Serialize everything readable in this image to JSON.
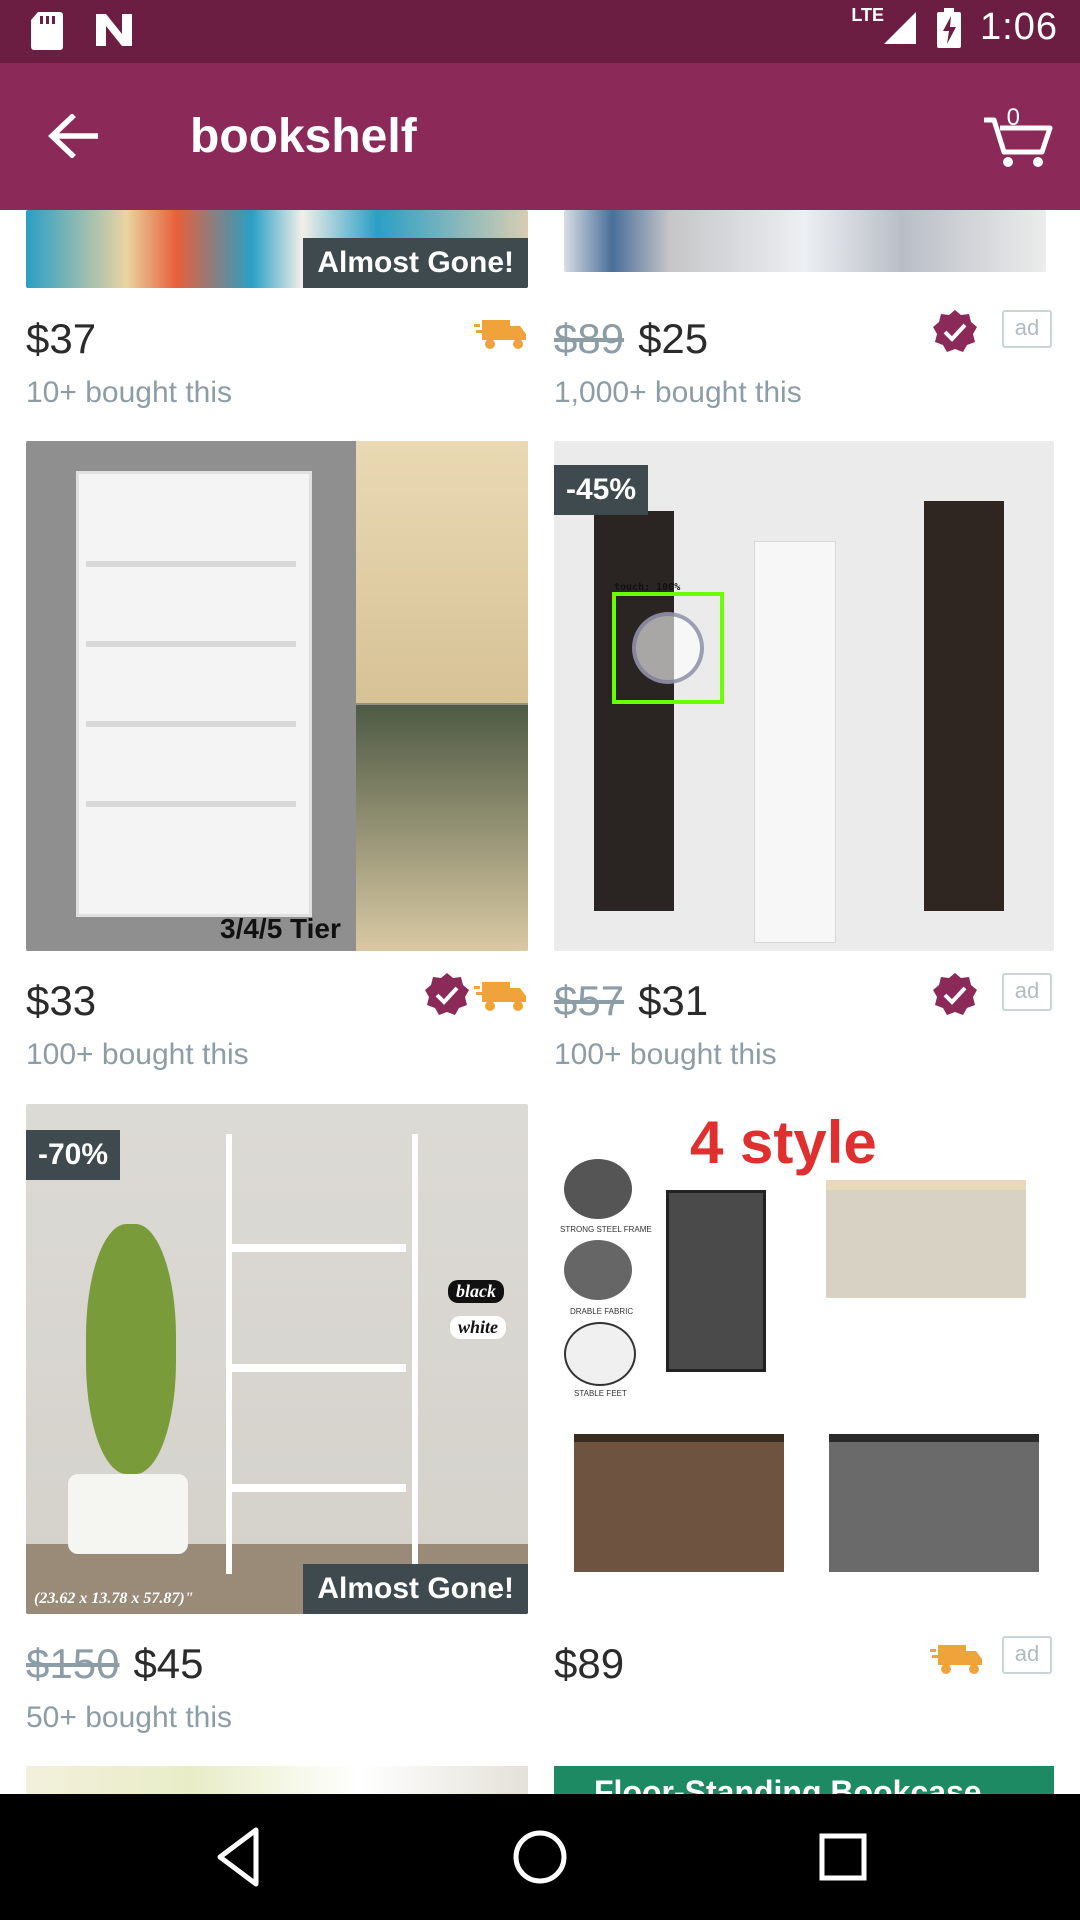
{
  "status_bar": {
    "time": "1:06",
    "network": "LTE"
  },
  "app_bar": {
    "title": "bookshelf",
    "cart_count": "0"
  },
  "products": [
    {
      "new_price": "$37",
      "old_price": "",
      "bought": "10+ bought this",
      "badge_br": "Almost Gone!",
      "badge_tl": "",
      "truck": true,
      "verified": false,
      "ad": false
    },
    {
      "new_price": "$25",
      "old_price": "$89",
      "bought": "1,000+ bought this",
      "badge_br": "",
      "badge_tl": "",
      "truck": false,
      "verified": true,
      "ad": true
    },
    {
      "new_price": "$33",
      "old_price": "",
      "bought": "100+ bought this",
      "badge_br": "",
      "image_caption": "3/4/5 Tier",
      "badge_tl": "",
      "truck": true,
      "verified": true,
      "ad": false
    },
    {
      "new_price": "$31",
      "old_price": "$57",
      "bought": "100+ bought this",
      "badge_br": "",
      "badge_tl": "-45%",
      "truck": false,
      "verified": true,
      "ad": true
    },
    {
      "new_price": "$45",
      "old_price": "$150",
      "bought": "50+ bought this",
      "badge_br": "Almost Gone!",
      "badge_tl": "-70%",
      "image_caption": "(23.62 x 13.78 x 57.87)\"",
      "truck": false,
      "verified": false,
      "ad": false
    },
    {
      "new_price": "$89",
      "old_price": "",
      "bought": "",
      "badge_br": "",
      "badge_tl": "",
      "image_caption": "4 style",
      "truck": true,
      "verified": false,
      "ad": true
    }
  ],
  "ad_label": "ad",
  "touch_overlay": "touch: 100%",
  "partial_banner": "Floor-Standing Bookcase",
  "image_texts": {
    "p5_black": "black",
    "p5_white": "white",
    "p6_frame": "STRONG STEEL FRAME",
    "p6_fabric": "DRABLE FABRIC",
    "p6_feet": "STABLE FEET"
  },
  "colors": {
    "status_bar": "#6b1e42",
    "app_bar": "#8b2a58",
    "accent": "#8b2a58",
    "truck": "#f0a33a"
  }
}
